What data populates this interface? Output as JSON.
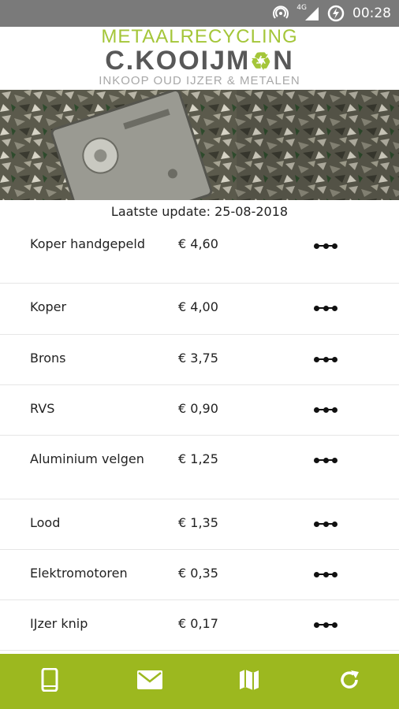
{
  "status_bar": {
    "network": "4G",
    "time": "00:28",
    "icons": [
      "hotspot-icon",
      "signal-icon",
      "data-saver-icon"
    ]
  },
  "header": {
    "logo_top": "METAALRECYCLING",
    "logo_main_left": "C.KOOIJM",
    "logo_main_right": "N",
    "logo_sub": "INKOOP OUD IJZER & METALEN"
  },
  "update_text": "Laatste update: 25-08-2018",
  "prices": [
    {
      "name": "Koper handgepeld",
      "price": "€ 4,60"
    },
    {
      "name": "Koper",
      "price": "€ 4,00"
    },
    {
      "name": "Brons",
      "price": "€ 3,75"
    },
    {
      "name": "RVS",
      "price": "€ 0,90"
    },
    {
      "name": "Aluminium velgen",
      "price": "€ 1,25"
    },
    {
      "name": "Lood",
      "price": "€ 1,35"
    },
    {
      "name": "Elektromotoren",
      "price": "€ 0,35"
    },
    {
      "name": "IJzer knip",
      "price": "€ 0,17"
    }
  ],
  "bottom_nav": {
    "items": [
      "phone-icon",
      "mail-icon",
      "map-icon",
      "refresh-icon"
    ]
  },
  "colors": {
    "accent": "#9cb81f",
    "logo_green": "#a4c639",
    "status_bar": "#7a7a7a"
  }
}
